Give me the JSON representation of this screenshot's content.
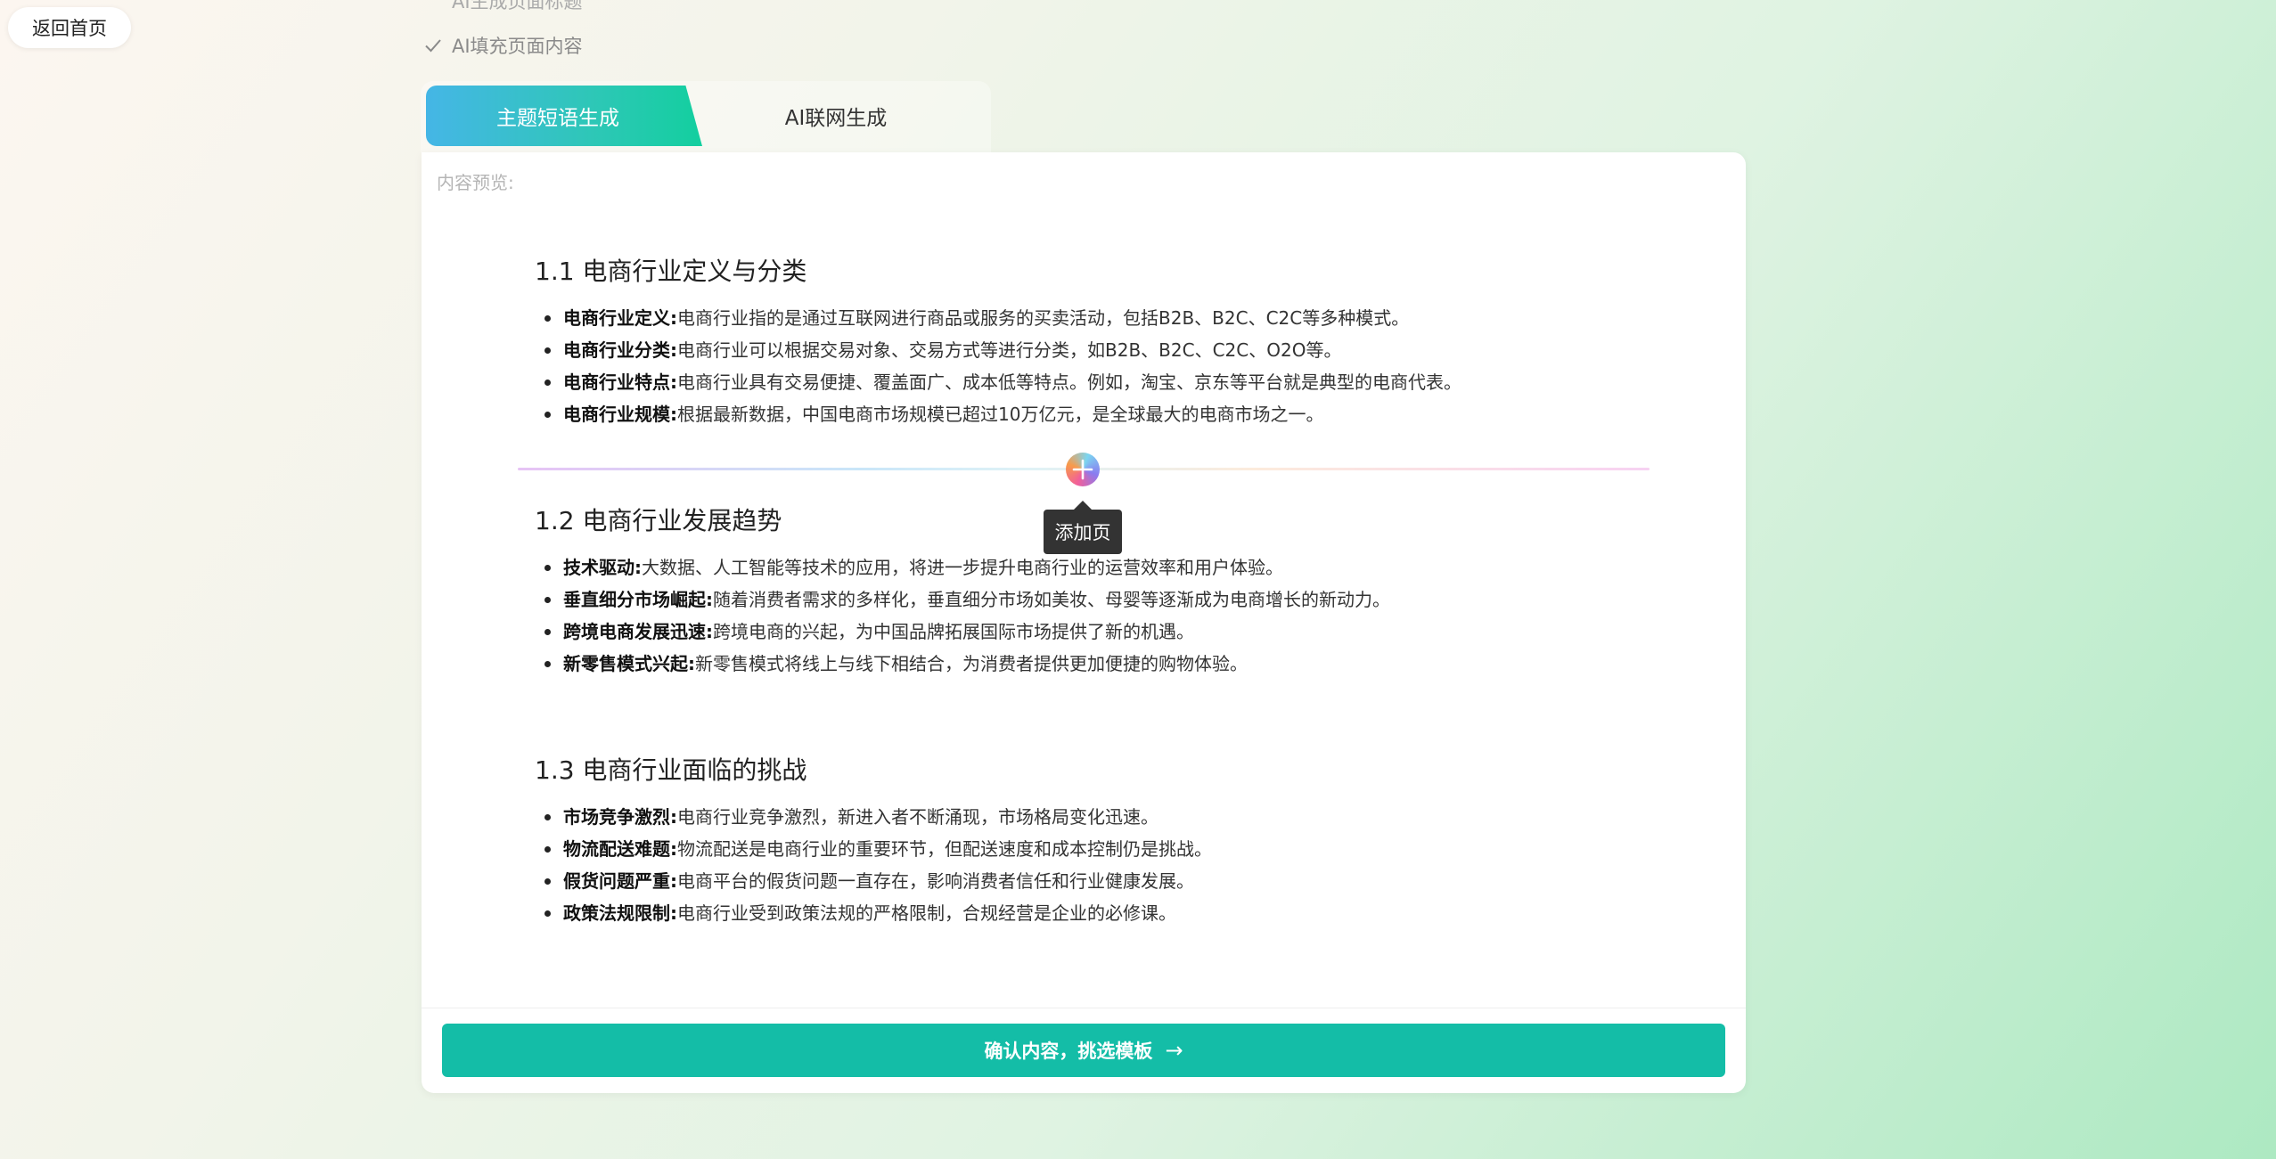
{
  "nav": {
    "back_label": "返回首页"
  },
  "steps": {
    "partial_label": "AI生成页面标题",
    "done_label": "AI填充页面内容"
  },
  "tabs": [
    {
      "label": "主题短语生成",
      "active": true
    },
    {
      "label": "AI联网生成",
      "active": false
    }
  ],
  "preview": {
    "label": "内容预览:",
    "sections": [
      {
        "title": "1.1 电商行业定义与分类",
        "items": [
          {
            "term": "电商行业定义:",
            "text": "电商行业指的是通过互联网进行商品或服务的买卖活动，包括B2B、B2C、C2C等多种模式。"
          },
          {
            "term": "电商行业分类:",
            "text": "电商行业可以根据交易对象、交易方式等进行分类，如B2B、B2C、C2C、O2O等。"
          },
          {
            "term": "电商行业特点:",
            "text": "电商行业具有交易便捷、覆盖面广、成本低等特点。例如，淘宝、京东等平台就是典型的电商代表。"
          },
          {
            "term": "电商行业规模:",
            "text": "根据最新数据，中国电商市场规模已超过10万亿元，是全球最大的电商市场之一。"
          }
        ]
      },
      {
        "title": "1.2 电商行业发展趋势",
        "items": [
          {
            "term": "技术驱动:",
            "text": "大数据、人工智能等技术的应用，将进一步提升电商行业的运营效率和用户体验。"
          },
          {
            "term": "垂直细分市场崛起:",
            "text": "随着消费者需求的多样化，垂直细分市场如美妆、母婴等逐渐成为电商增长的新动力。"
          },
          {
            "term": "跨境电商发展迅速:",
            "text": "跨境电商的兴起，为中国品牌拓展国际市场提供了新的机遇。"
          },
          {
            "term": "新零售模式兴起:",
            "text": "新零售模式将线上与线下相结合，为消费者提供更加便捷的购物体验。"
          }
        ]
      },
      {
        "title": "1.3 电商行业面临的挑战",
        "items": [
          {
            "term": "市场竞争激烈:",
            "text": "电商行业竞争激烈，新进入者不断涌现，市场格局变化迅速。"
          },
          {
            "term": "物流配送难题:",
            "text": "物流配送是电商行业的重要环节，但配送速度和成本控制仍是挑战。"
          },
          {
            "term": "假货问题严重:",
            "text": "电商平台的假货问题一直存在，影响消费者信任和行业健康发展。"
          },
          {
            "term": "政策法规限制:",
            "text": "电商行业受到政策法规的严格限制，合规经营是企业的必修课。"
          }
        ]
      }
    ],
    "add_page_tooltip": "添加页"
  },
  "footer": {
    "confirm_label": "确认内容，挑选模板",
    "arrow": "→"
  },
  "colors": {
    "accent": "#14bda7",
    "tab_gradient_start": "#45b6e6",
    "tab_gradient_end": "#13cf9f",
    "tooltip_bg": "#333333"
  },
  "icons": {
    "check": "check-icon",
    "add": "plus-icon",
    "arrow": "arrow-right-icon"
  }
}
